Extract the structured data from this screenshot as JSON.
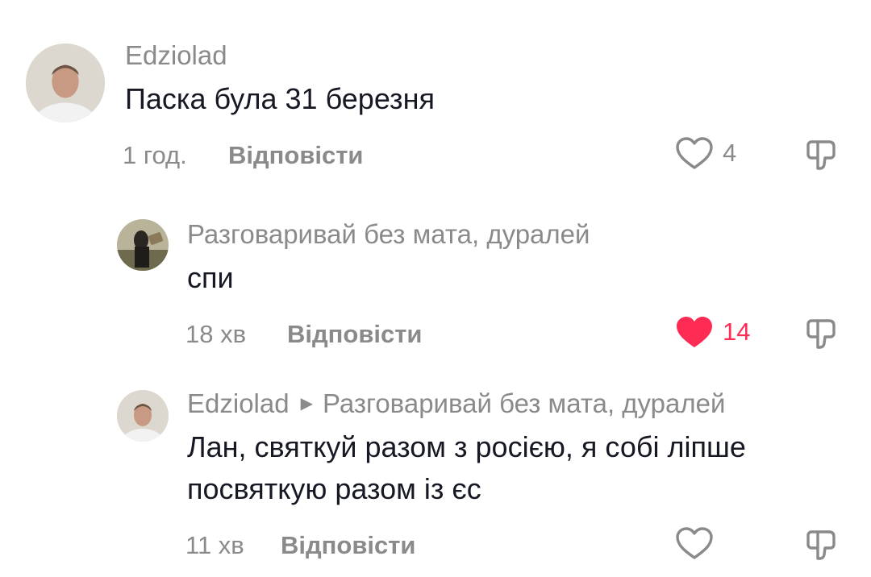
{
  "comments": [
    {
      "username": "Edziolad",
      "text": "Паска була 31 березня",
      "time": "1 год.",
      "reply_label": "Відповісти",
      "likes": "4",
      "liked": false
    },
    {
      "username": "Разговаривай без мата, дуралей",
      "text": "спи",
      "time": "18 хв",
      "reply_label": "Відповісти",
      "likes": "14",
      "liked": true
    },
    {
      "username": "Edziolad",
      "reply_to": "Разговаривай без мата, дуралей",
      "text_lines": [
        "Лан, святкуй разом з росією, я собі ліпше",
        "посвяткую разом із єс"
      ],
      "time": "11 хв",
      "reply_label": "Відповісти",
      "likes": "",
      "liked": false
    }
  ],
  "colors": {
    "accent_like": "#fe2c55",
    "muted_text": "#8a8a8a",
    "primary_text": "#161823"
  },
  "icons": {
    "like": "heart-icon",
    "dislike": "thumbs-down-icon",
    "reply_arrow": "caret-right-icon"
  }
}
